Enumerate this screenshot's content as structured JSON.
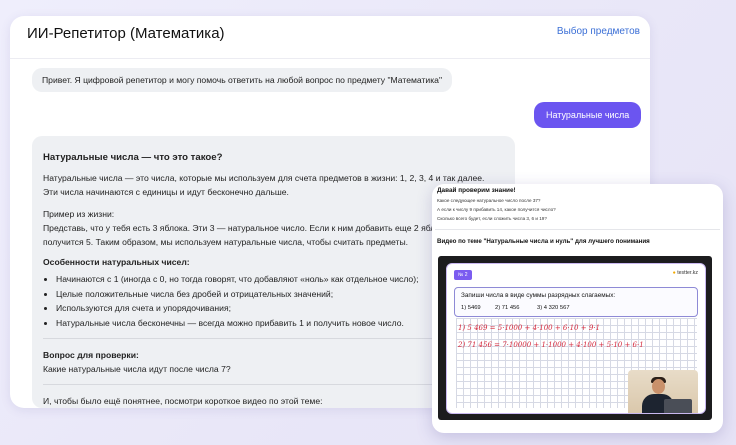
{
  "header": {
    "title": "ИИ-Репетитор (Математика)",
    "subjects_link": "Выбор предметов"
  },
  "chat": {
    "bot_greeting": "Привет. Я цифровой репетитор и могу помочь ответить на любой вопрос по предмету \"Математика\"",
    "user_message": "Натуральные числа",
    "answer": {
      "heading": "Натуральные числа — что это такое?",
      "intro_line1": "Натуральные числа — это числа, которые мы используем для счета предметов в жизни: 1, 2, 3, 4 и так далее.",
      "intro_line2": "Эти числа начинаются с единицы и идут бесконечно дальше.",
      "example_label": "Пример из жизни:",
      "example_line1": "Представь, что у тебя есть 3 яблока. Эти 3 — натуральное число. Если к ним добавить еще 2 яблока,",
      "example_line2": "получится 5. Таким образом, мы используем натуральные числа, чтобы считать предметы.",
      "features_heading": "Особенности натуральных чисел:",
      "features": [
        "Начинаются с 1 (иногда с 0, но тогда говорят, что добавляют «ноль» как отдельное число);",
        "Целые положительные числа без дробей и отрицательных значений;",
        "Используются для счета и упорядочивания;",
        "Натуральные числа бесконечны — всегда можно прибавить 1 и получить новое число."
      ],
      "check_heading": "Вопрос для проверки:",
      "check_question": "Какие натуральные числа идут после числа 7?",
      "video_prompt": "И, чтобы было ещё понятнее, посмотри короткое видео по этой теме:"
    }
  },
  "overlay": {
    "quiz_title": "Давай проверим знание!",
    "quiz_questions": [
      "Какое следующее натуральное число после 37?",
      "А если к числу 9 прибавить 14, какое получится число?",
      "Сколько всего будет, если сложить числа 3, 6 и 19?"
    ],
    "video_title": "Видео по теме \"Натуральные числа и нуль\" для лучшего понимания",
    "slide": {
      "badge": "№ 2",
      "logo": "testter.kz",
      "task_title": "Запиши числа в виде суммы разрядных слагаемых:",
      "items": [
        "1) 5469",
        "2) 71 456",
        "3) 4 320 567"
      ],
      "hw_line1": "1) 5 469 = 5·1000 + 4·100 + 6·10 + 9·1",
      "hw_line2": "2) 71 456 = 7·10000 + 1·1000 + 4·100 + 5·10 + 6·1"
    }
  },
  "colors": {
    "accent": "#6b55f0",
    "link": "#3b6fd6",
    "bubble": "#eef0f3",
    "handwriting": "#d5273a"
  }
}
